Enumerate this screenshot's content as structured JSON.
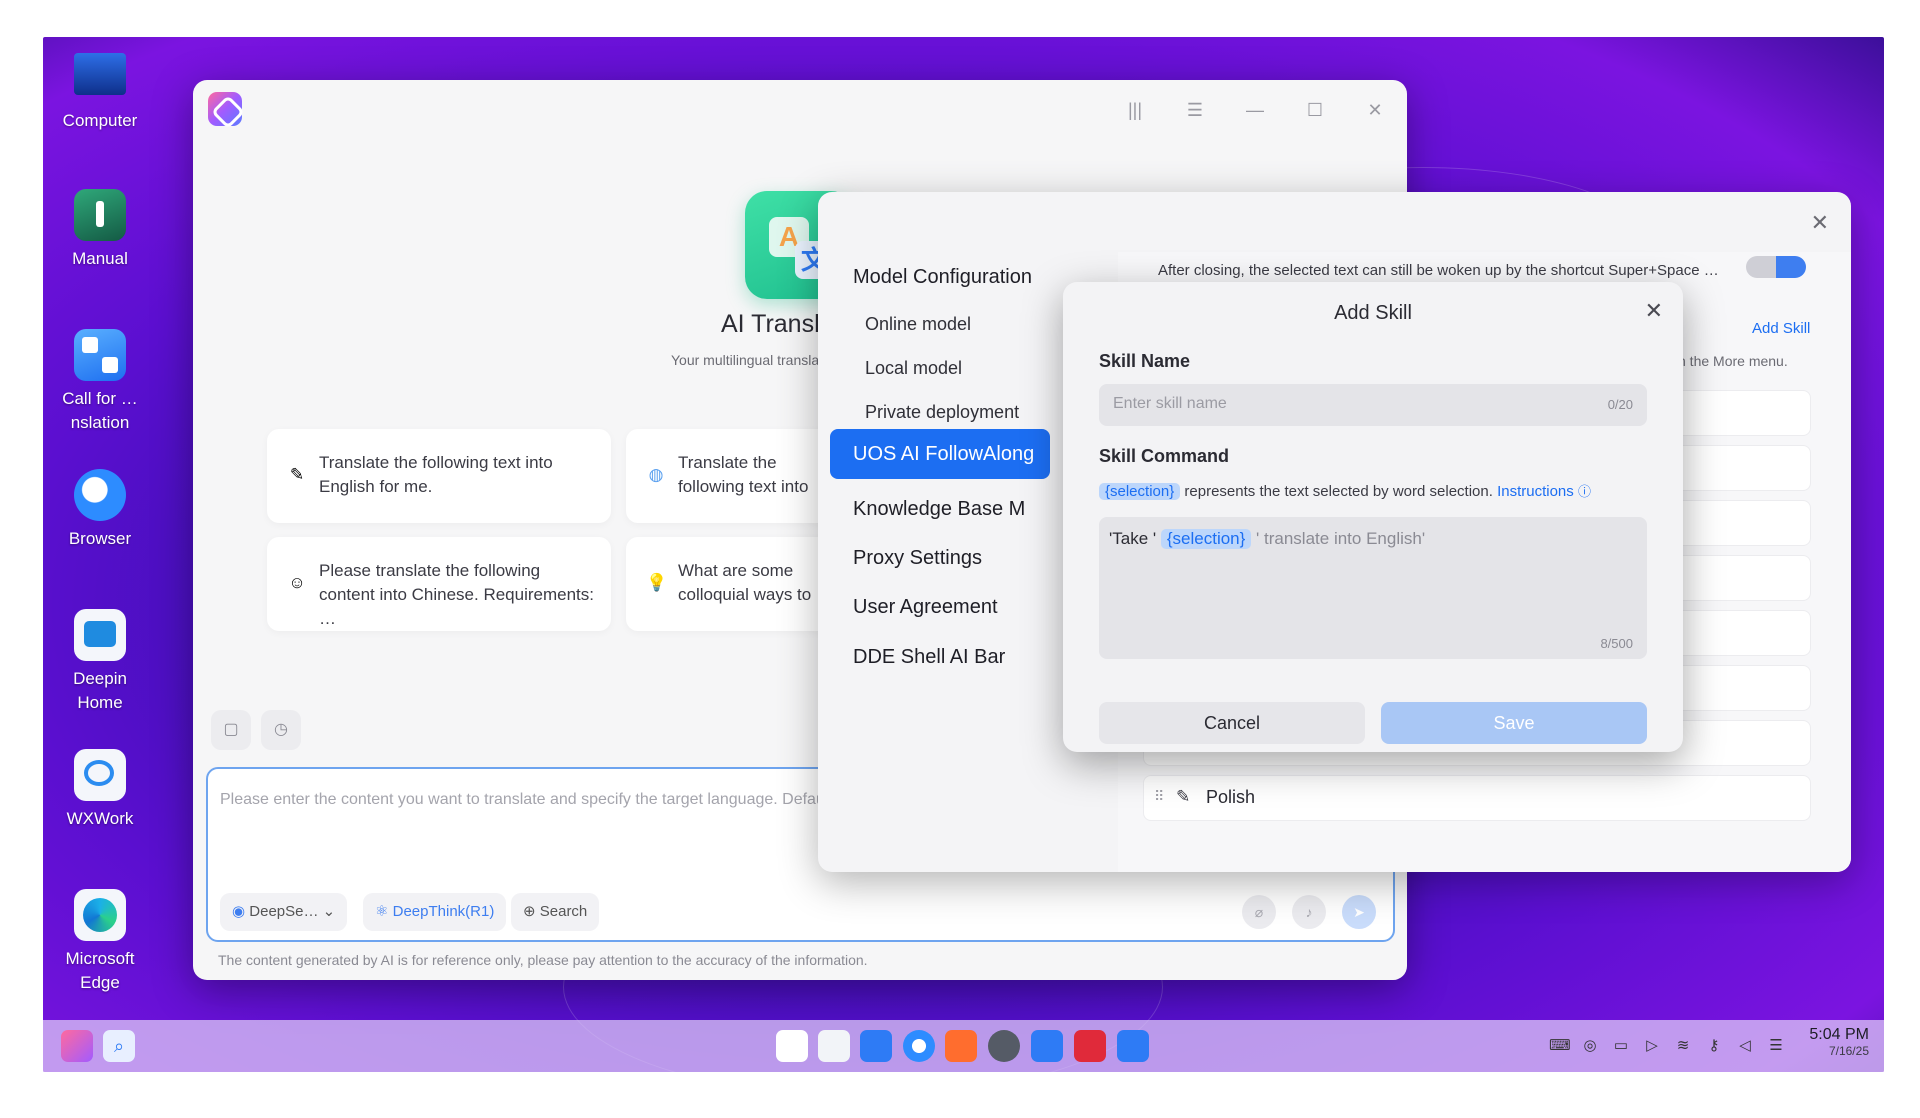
{
  "desktop": {
    "icons": [
      {
        "label": "Computer",
        "icon": "computer-icon"
      },
      {
        "label": "Manual",
        "icon": "manual-icon"
      },
      {
        "label": "Call for …nslation",
        "icon": "call-for-translation-icon"
      },
      {
        "label": "Browser",
        "icon": "browser-icon"
      },
      {
        "label": "Deepin Home",
        "icon": "deepin-home-icon"
      },
      {
        "label": "WXWork",
        "icon": "wxwork-icon"
      },
      {
        "label": "Microsoft Edge",
        "icon": "microsoft-edge-icon"
      }
    ]
  },
  "ai_window": {
    "app_title": "AI Translatio",
    "app_subtitle": "Your multilingual translatio",
    "prompts": [
      "Translate the following text into English for me.",
      "Translate the following text into Chinese.",
      "Please translate the following content into Chinese. Requirements: …",
      "What are some colloquial ways to address a friend in English"
    ],
    "input_placeholder": "Please enter the content you want to translate and specify the target language. Default",
    "chips": {
      "model": "DeepSe…",
      "deepthink": "DeepThink(R1)",
      "search": "Search"
    },
    "disclaimer": "The content generated by AI is for reference only, please pay attention to the accuracy of the information."
  },
  "settings": {
    "nav": {
      "model_configuration": "Model Configuration",
      "online_model": "Online model",
      "local_model": "Local model",
      "private_deployment": "Private deployment",
      "followalong": "UOS AI FollowAlong",
      "knowledge_base": "Knowledge Base M",
      "proxy_settings": "Proxy Settings",
      "user_agreement": "User Agreement",
      "dde_shell": "DDE Shell AI Bar"
    },
    "right": {
      "closing_note": "After closing, the selected text can still be woken up by the shortcut Super+Space …",
      "add_skill_link": "Add Skill",
      "more_menu_note": "n the More menu.",
      "polish_label": "Polish"
    }
  },
  "add_skill": {
    "title": "Add Skill",
    "skill_name_label": "Skill Name",
    "skill_name_placeholder": "Enter skill name",
    "skill_name_counter": "0/20",
    "skill_command_label": "Skill Command",
    "selection_token": "{selection}",
    "hint_text": "represents the text selected by word selection.",
    "instructions_link": "Instructions",
    "command_prefix": "'Take '",
    "command_suffix": "' translate into English'",
    "command_counter": "8/500",
    "cancel_label": "Cancel",
    "save_label": "Save"
  },
  "taskbar": {
    "clock_time": "5:04 PM",
    "clock_date": "7/16/25"
  },
  "colors": {
    "accent": "#1c6ef2",
    "desktop_bg": "#4a12c0"
  }
}
